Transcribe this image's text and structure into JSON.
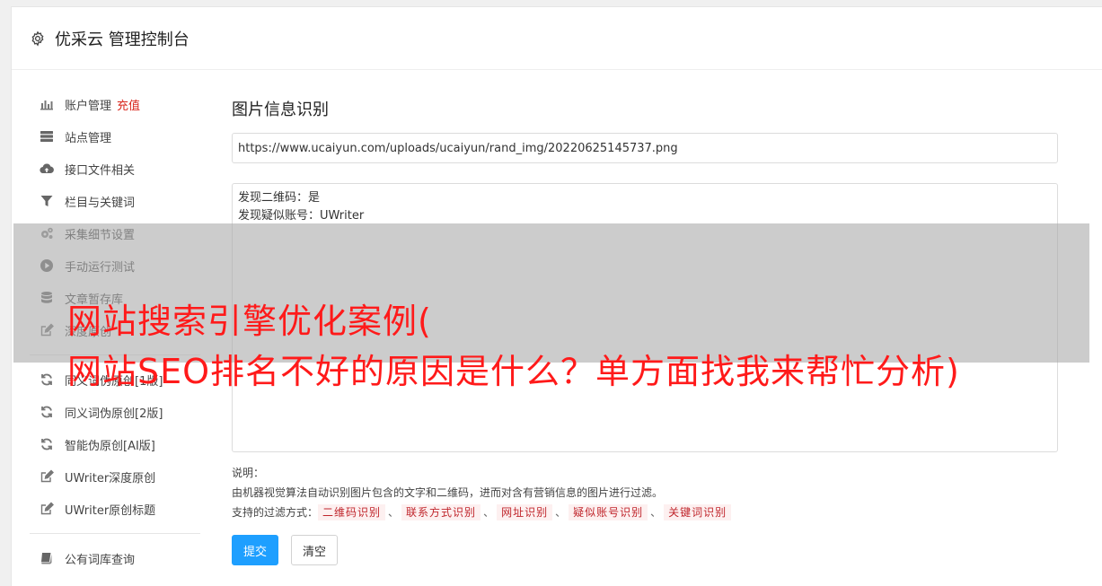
{
  "header": {
    "title": "优采云 管理控制台",
    "icon": "gear-icon"
  },
  "sidebar": {
    "groups": [
      [
        {
          "label": "账户管理",
          "icon": "bar-chart-icon",
          "badge": "充值"
        },
        {
          "label": "站点管理",
          "icon": "server-icon"
        },
        {
          "label": "接口文件相关",
          "icon": "cloud-upload-icon"
        },
        {
          "label": "栏目与关键词",
          "icon": "filter-icon"
        },
        {
          "label": "采集细节设置",
          "icon": "gears-icon"
        },
        {
          "label": "手动运行测试",
          "icon": "play-circle-icon"
        },
        {
          "label": "文章暂存库",
          "icon": "database-icon"
        },
        {
          "label": "深度原创",
          "icon": "edit-icon"
        }
      ],
      [
        {
          "label": "同义词伪原创[1版]",
          "icon": "refresh-icon"
        },
        {
          "label": "同义词伪原创[2版]",
          "icon": "refresh-icon"
        },
        {
          "label": "智能伪原创[AI版]",
          "icon": "refresh-icon"
        },
        {
          "label": "UWriter深度原创",
          "icon": "edit-icon"
        },
        {
          "label": "UWriter原创标题",
          "icon": "edit-icon"
        }
      ],
      [
        {
          "label": "公有词库查询",
          "icon": "book-icon"
        }
      ]
    ]
  },
  "main": {
    "title": "图片信息识别",
    "url_value": "https://www.ucaiyun.com/uploads/ucaiyun/rand_img/20220625145737.png",
    "result_lines": [
      "发现二维码：是",
      "发现疑似账号：UWriter"
    ],
    "note_title": "说明：",
    "note_desc": "由机器视觉算法自动识别图片包含的文字和二维码，进而对含有营销信息的图片进行过滤。",
    "filters_label": "支持的过滤方式：",
    "filters": [
      "二维码识别",
      "联系方式识别",
      "网址识别",
      "疑似账号识别",
      "关键词识别"
    ],
    "filter_separator": "、",
    "submit_label": "提交",
    "clear_label": "清空"
  },
  "overlay": {
    "headline_line1": "网站搜索引擎优化案例(",
    "headline_line2": "网站SEO排名不好的原因是什么？单方面找我来帮忙分析)"
  },
  "colors": {
    "primary": "#1e9fff",
    "accent": "#d9261c",
    "headline": "#ff1a1a"
  }
}
